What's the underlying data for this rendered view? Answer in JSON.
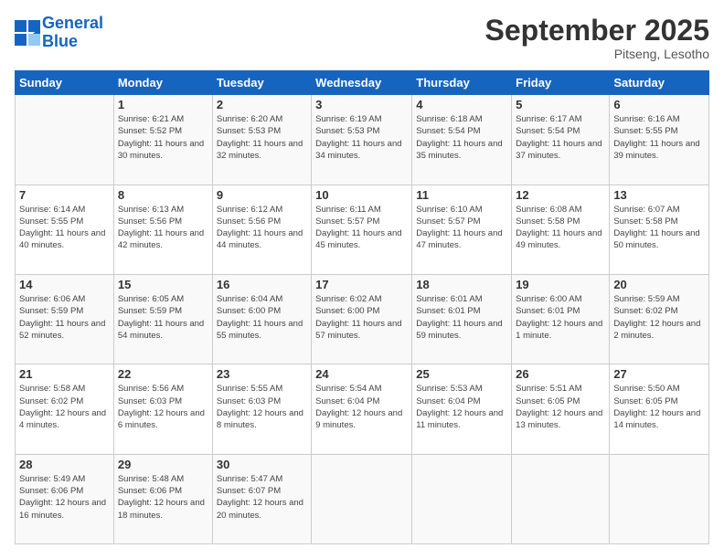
{
  "header": {
    "logo_line1": "General",
    "logo_line2": "Blue",
    "month": "September 2025",
    "location": "Pitseng, Lesotho"
  },
  "days_of_week": [
    "Sunday",
    "Monday",
    "Tuesday",
    "Wednesday",
    "Thursday",
    "Friday",
    "Saturday"
  ],
  "weeks": [
    [
      {
        "day": "",
        "info": ""
      },
      {
        "day": "1",
        "info": "Sunrise: 6:21 AM\nSunset: 5:52 PM\nDaylight: 11 hours\nand 30 minutes."
      },
      {
        "day": "2",
        "info": "Sunrise: 6:20 AM\nSunset: 5:53 PM\nDaylight: 11 hours\nand 32 minutes."
      },
      {
        "day": "3",
        "info": "Sunrise: 6:19 AM\nSunset: 5:53 PM\nDaylight: 11 hours\nand 34 minutes."
      },
      {
        "day": "4",
        "info": "Sunrise: 6:18 AM\nSunset: 5:54 PM\nDaylight: 11 hours\nand 35 minutes."
      },
      {
        "day": "5",
        "info": "Sunrise: 6:17 AM\nSunset: 5:54 PM\nDaylight: 11 hours\nand 37 minutes."
      },
      {
        "day": "6",
        "info": "Sunrise: 6:16 AM\nSunset: 5:55 PM\nDaylight: 11 hours\nand 39 minutes."
      }
    ],
    [
      {
        "day": "7",
        "info": "Sunrise: 6:14 AM\nSunset: 5:55 PM\nDaylight: 11 hours\nand 40 minutes."
      },
      {
        "day": "8",
        "info": "Sunrise: 6:13 AM\nSunset: 5:56 PM\nDaylight: 11 hours\nand 42 minutes."
      },
      {
        "day": "9",
        "info": "Sunrise: 6:12 AM\nSunset: 5:56 PM\nDaylight: 11 hours\nand 44 minutes."
      },
      {
        "day": "10",
        "info": "Sunrise: 6:11 AM\nSunset: 5:57 PM\nDaylight: 11 hours\nand 45 minutes."
      },
      {
        "day": "11",
        "info": "Sunrise: 6:10 AM\nSunset: 5:57 PM\nDaylight: 11 hours\nand 47 minutes."
      },
      {
        "day": "12",
        "info": "Sunrise: 6:08 AM\nSunset: 5:58 PM\nDaylight: 11 hours\nand 49 minutes."
      },
      {
        "day": "13",
        "info": "Sunrise: 6:07 AM\nSunset: 5:58 PM\nDaylight: 11 hours\nand 50 minutes."
      }
    ],
    [
      {
        "day": "14",
        "info": "Sunrise: 6:06 AM\nSunset: 5:59 PM\nDaylight: 11 hours\nand 52 minutes."
      },
      {
        "day": "15",
        "info": "Sunrise: 6:05 AM\nSunset: 5:59 PM\nDaylight: 11 hours\nand 54 minutes."
      },
      {
        "day": "16",
        "info": "Sunrise: 6:04 AM\nSunset: 6:00 PM\nDaylight: 11 hours\nand 55 minutes."
      },
      {
        "day": "17",
        "info": "Sunrise: 6:02 AM\nSunset: 6:00 PM\nDaylight: 11 hours\nand 57 minutes."
      },
      {
        "day": "18",
        "info": "Sunrise: 6:01 AM\nSunset: 6:01 PM\nDaylight: 11 hours\nand 59 minutes."
      },
      {
        "day": "19",
        "info": "Sunrise: 6:00 AM\nSunset: 6:01 PM\nDaylight: 12 hours\nand 1 minute."
      },
      {
        "day": "20",
        "info": "Sunrise: 5:59 AM\nSunset: 6:02 PM\nDaylight: 12 hours\nand 2 minutes."
      }
    ],
    [
      {
        "day": "21",
        "info": "Sunrise: 5:58 AM\nSunset: 6:02 PM\nDaylight: 12 hours\nand 4 minutes."
      },
      {
        "day": "22",
        "info": "Sunrise: 5:56 AM\nSunset: 6:03 PM\nDaylight: 12 hours\nand 6 minutes."
      },
      {
        "day": "23",
        "info": "Sunrise: 5:55 AM\nSunset: 6:03 PM\nDaylight: 12 hours\nand 8 minutes."
      },
      {
        "day": "24",
        "info": "Sunrise: 5:54 AM\nSunset: 6:04 PM\nDaylight: 12 hours\nand 9 minutes."
      },
      {
        "day": "25",
        "info": "Sunrise: 5:53 AM\nSunset: 6:04 PM\nDaylight: 12 hours\nand 11 minutes."
      },
      {
        "day": "26",
        "info": "Sunrise: 5:51 AM\nSunset: 6:05 PM\nDaylight: 12 hours\nand 13 minutes."
      },
      {
        "day": "27",
        "info": "Sunrise: 5:50 AM\nSunset: 6:05 PM\nDaylight: 12 hours\nand 14 minutes."
      }
    ],
    [
      {
        "day": "28",
        "info": "Sunrise: 5:49 AM\nSunset: 6:06 PM\nDaylight: 12 hours\nand 16 minutes."
      },
      {
        "day": "29",
        "info": "Sunrise: 5:48 AM\nSunset: 6:06 PM\nDaylight: 12 hours\nand 18 minutes."
      },
      {
        "day": "30",
        "info": "Sunrise: 5:47 AM\nSunset: 6:07 PM\nDaylight: 12 hours\nand 20 minutes."
      },
      {
        "day": "",
        "info": ""
      },
      {
        "day": "",
        "info": ""
      },
      {
        "day": "",
        "info": ""
      },
      {
        "day": "",
        "info": ""
      }
    ]
  ]
}
